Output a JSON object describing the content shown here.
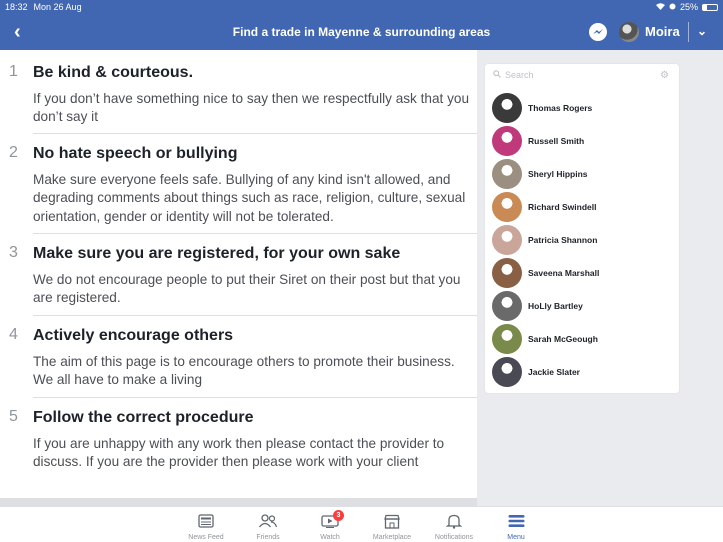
{
  "status_bar": {
    "time": "18:32",
    "date": "Mon 26 Aug",
    "battery": "25%",
    "battery_level": 0.25
  },
  "header": {
    "title": "Find a trade in Mayenne & surrounding areas",
    "user_name": "Moira"
  },
  "rules": [
    {
      "number": "1",
      "title": "Be kind & courteous.",
      "body": "If you don’t have something nice to say then we respectfully ask that you don’t say it"
    },
    {
      "number": "2",
      "title": "No hate speech or bullying",
      "body": "Make sure everyone feels safe. Bullying of any kind isn't allowed, and degrading comments about things such as race, religion, culture, sexual orientation, gender or identity will not be tolerated."
    },
    {
      "number": "3",
      "title": "Make sure you are registered, for your own sake",
      "body": "We do not encourage people to put their Siret on their post but that you are registered."
    },
    {
      "number": "4",
      "title": "Actively encourage others",
      "body": "The aim of this page is to encourage others to promote their business. We all have to make a living"
    },
    {
      "number": "5",
      "title": "Follow the correct procedure",
      "body": "If you are unhappy with any work then please contact the provider to discuss. If you are the provider then please work with your client"
    }
  ],
  "sidebar": {
    "search_placeholder": "Search",
    "contacts": [
      {
        "name": "Thomas Rogers",
        "color": "#3a3a3a"
      },
      {
        "name": "Russell Smith",
        "color": "#c0397a"
      },
      {
        "name": "Sheryl Hippins",
        "color": "#9a8f80"
      },
      {
        "name": "Richard Swindell",
        "color": "#c98a55"
      },
      {
        "name": "Patricia Shannon",
        "color": "#c9a59a"
      },
      {
        "name": "Saveena Marshall",
        "color": "#8a6045"
      },
      {
        "name": "HoLly Bartley",
        "color": "#6a6a6a"
      },
      {
        "name": "Sarah McGeough",
        "color": "#7a8a4a"
      },
      {
        "name": "Jackie Slater",
        "color": "#4a4a55"
      }
    ]
  },
  "tabs": [
    {
      "label": "News Feed",
      "icon": "news-feed-icon"
    },
    {
      "label": "Friends",
      "icon": "friends-icon"
    },
    {
      "label": "Watch",
      "icon": "watch-icon",
      "badge": "3"
    },
    {
      "label": "Marketplace",
      "icon": "marketplace-icon"
    },
    {
      "label": "Notifications",
      "icon": "bell-icon"
    },
    {
      "label": "Menu",
      "icon": "menu-icon",
      "active": true
    }
  ],
  "colors": {
    "brand": "#4267b2",
    "badge": "#fa3e3e"
  }
}
